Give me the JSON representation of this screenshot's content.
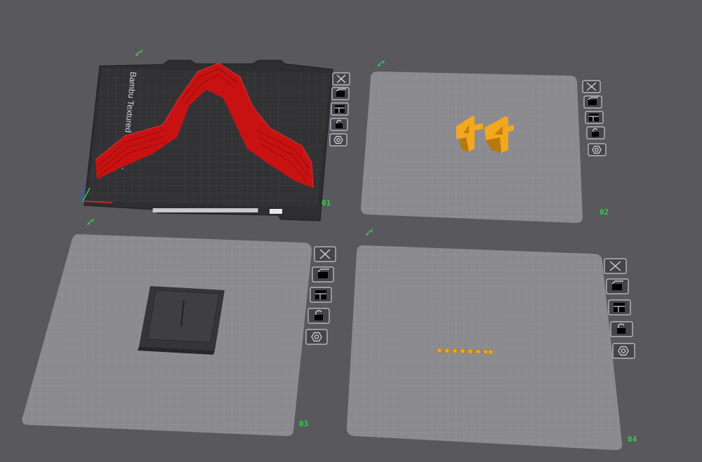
{
  "colors": {
    "background": "#58585d",
    "plate_surface": "#8a8a8f",
    "plate_grid": "#9b9b9f",
    "active_plate_surface": "#303033",
    "active_plate_grid": "#4a4a4e",
    "label_green": "#33cc55",
    "model_red": "#cc1111",
    "model_yellow": "#f2a81d",
    "model_dark": "#3a3a3c"
  },
  "plates": [
    {
      "number": "01",
      "active": true,
      "plate_text": "Bambu Textured PEI Pla...",
      "toolbar": [
        "close-icon",
        "arrange-icon",
        "orient-icon",
        "lock-icon",
        "settings-icon"
      ],
      "edit_icon": "edit-pencil-icon"
    },
    {
      "number": "02",
      "active": false,
      "toolbar": [
        "close-icon",
        "arrange-icon",
        "orient-icon",
        "lock-icon",
        "settings-icon"
      ],
      "edit_icon": "edit-pencil-icon"
    },
    {
      "number": "03",
      "active": false,
      "toolbar": [
        "close-icon",
        "arrange-icon",
        "orient-icon",
        "lock-icon",
        "settings-icon"
      ],
      "edit_icon": "edit-pencil-icon"
    },
    {
      "number": "04",
      "active": false,
      "toolbar": [
        "close-icon",
        "arrange-icon",
        "orient-icon",
        "lock-icon",
        "settings-icon"
      ],
      "edit_icon": "edit-pencil-icon"
    }
  ],
  "models": [
    {
      "plate": "01",
      "name": "red arch model",
      "color": "#cc1111"
    },
    {
      "plate": "02",
      "name": "yellow figure pair",
      "color": "#f2a81d"
    },
    {
      "plate": "03",
      "name": "dark square tray",
      "color": "#3a3a3c"
    },
    {
      "plate": "04",
      "name": "row of small stars",
      "color": "#f2a81d"
    }
  ]
}
